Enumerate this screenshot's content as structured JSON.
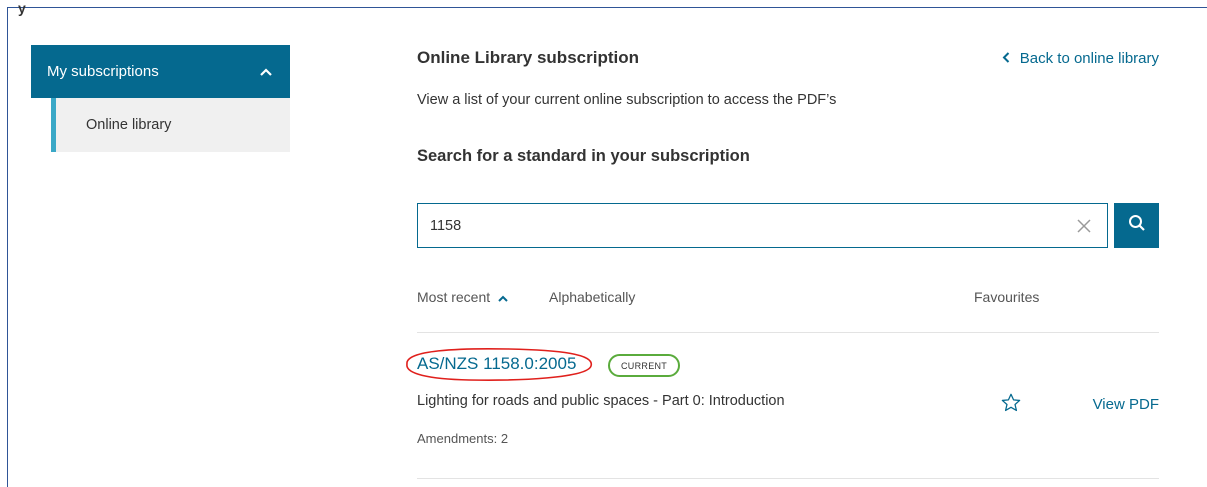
{
  "sidebar": {
    "header_label": "My subscriptions",
    "items": [
      {
        "label": "Online library"
      }
    ]
  },
  "main": {
    "title": "Online Library subscription",
    "back_link": "Back to online library",
    "subtitle": "View a list of your current online subscription to access the PDF’s",
    "search_heading": "Search for a standard in your subscription",
    "search": {
      "value": "1158",
      "placeholder": ""
    },
    "sort": {
      "most_recent": "Most recent",
      "alphabetically": "Alphabetically",
      "favourites": "Favourites"
    },
    "results": [
      {
        "code": "AS/NZS 1158.0:2005",
        "status": "CURRENT",
        "description": "Lighting for roads and public spaces - Part 0: Introduction",
        "amendments_label": "Amendments:",
        "amendments_count": "2",
        "action": "View PDF"
      }
    ]
  },
  "colors": {
    "accent": "#05698f",
    "sidebar_active_bar": "#3aa8c7",
    "badge_border": "#5aab3c",
    "annotation_red": "#e0201c"
  },
  "icons": {
    "sidebar_toggle": "chevron-up-icon",
    "back": "chevron-left-icon",
    "clear": "close-icon",
    "search": "search-icon",
    "sort": "chevron-up-icon",
    "favourite": "star-outline-icon"
  }
}
